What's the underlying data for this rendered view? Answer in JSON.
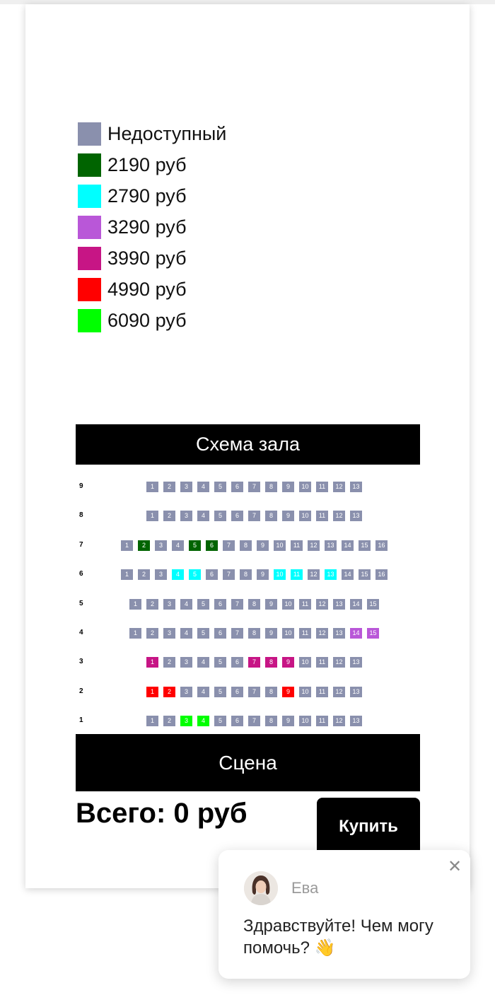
{
  "legend": [
    {
      "label": "Недоступный",
      "color": "#8a90ad"
    },
    {
      "label": "2190 руб",
      "color": "#006400"
    },
    {
      "label": "2790 руб",
      "color": "#00ffff"
    },
    {
      "label": "3290 руб",
      "color": "#b957d8"
    },
    {
      "label": "3990 руб",
      "color": "#c71585"
    },
    {
      "label": "4990 руб",
      "color": "#ff0000"
    },
    {
      "label": "6090 руб",
      "color": "#00ff00"
    }
  ],
  "hall": {
    "title": "Схема зала",
    "stage": "Сцена",
    "rows": [
      {
        "label": "9",
        "start_seat": 1,
        "seats": 13,
        "colored": {}
      },
      {
        "label": "8",
        "start_seat": 1,
        "seats": 13,
        "colored": {}
      },
      {
        "label": "7",
        "start_seat": 1,
        "seats": 16,
        "colored": {
          "2": "#006400",
          "5": "#006400",
          "6": "#006400"
        }
      },
      {
        "label": "6",
        "start_seat": 1,
        "seats": 16,
        "colored": {
          "4": "#00ffff",
          "5": "#00ffff",
          "10": "#00ffff",
          "11": "#00ffff",
          "13": "#00ffff"
        }
      },
      {
        "label": "5",
        "start_seat": 1,
        "seats": 15,
        "colored": {}
      },
      {
        "label": "4",
        "start_seat": 1,
        "seats": 15,
        "colored": {
          "14": "#b957d8",
          "15": "#b957d8"
        }
      },
      {
        "label": "3",
        "start_seat": 1,
        "seats": 13,
        "colored": {
          "1": "#c71585",
          "7": "#c71585",
          "8": "#c71585",
          "9": "#c71585"
        }
      },
      {
        "label": "2",
        "start_seat": 1,
        "seats": 13,
        "colored": {
          "1": "#ff0000",
          "2": "#ff0000",
          "9": "#ff0000"
        }
      },
      {
        "label": "1",
        "start_seat": 1,
        "seats": 13,
        "colored": {
          "3": "#00ff00",
          "4": "#00ff00"
        }
      }
    ]
  },
  "summary": {
    "total_label": "Всего: 0 руб",
    "buy_label": "Купить"
  },
  "chat": {
    "agent_name": "Ева",
    "message": "Здравствуйте! Чем могу помочь? 👋",
    "close_icon": "close-icon"
  }
}
